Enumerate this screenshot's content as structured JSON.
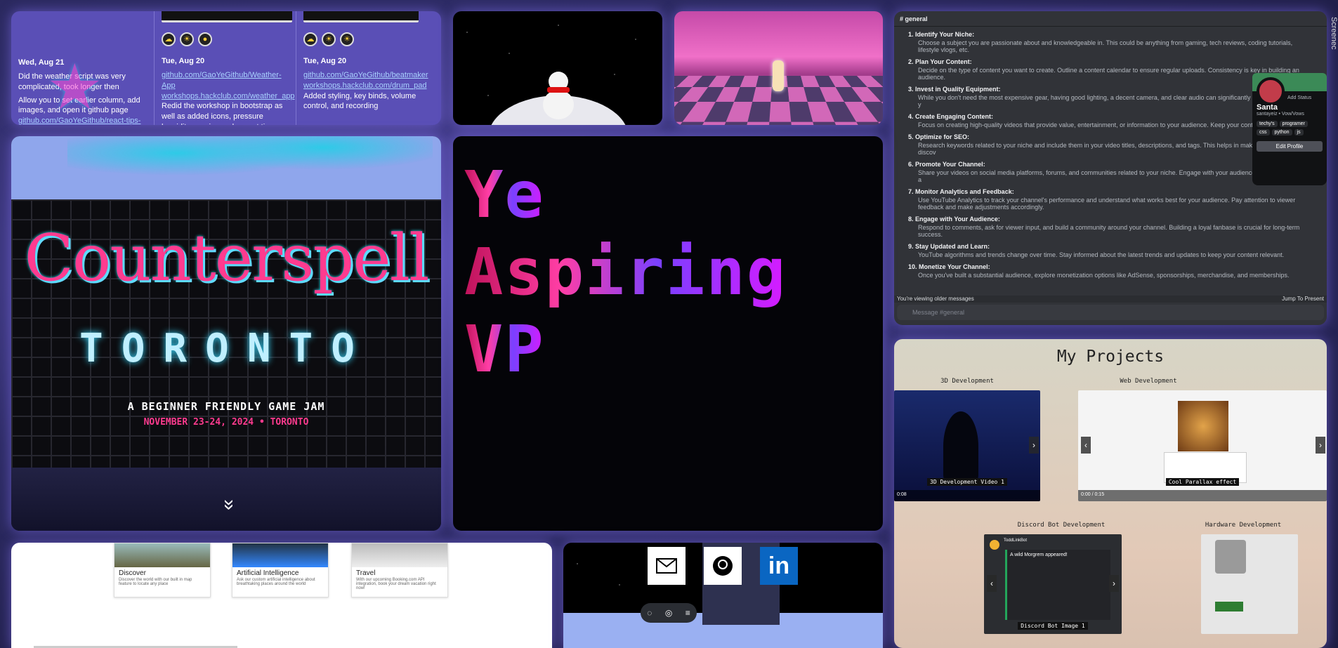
{
  "timeline": {
    "entries": [
      {
        "date": "Wed, Aug 21",
        "text1": "Did the weather script was very complicated, took longer then",
        "text2": "Allow you to set earlier column, add images, and open it github page",
        "link": "github.com/GaoYeGithub/react-tips-list"
      },
      {
        "date": "Tue, Aug 20",
        "link": "github.com/GaoYeGithub/Weather-App",
        "link2": "workshops.hackclub.com/weather_app",
        "text": "Redid the workshop in bootstrap as well as added icons, pressure humidity, sunrise and sunset time, time zone and more"
      },
      {
        "date": "Tue, Aug 20",
        "link": "github.com/GaoYeGithub/beatmaker",
        "link2": "workshops.hackclub.com/drum_pad",
        "text": "Added styling, key binds, volume control, and recording"
      }
    ]
  },
  "discord": {
    "channel": "general",
    "items": [
      {
        "h": "1. Identify Your Niche:",
        "d": "Choose a subject you are passionate about and knowledgeable in. This could be anything from gaming, tech reviews, coding tutorials, lifestyle vlogs, etc."
      },
      {
        "h": "2. Plan Your Content:",
        "d": "Decide on the type of content you want to create. Outline a content calendar to ensure regular uploads. Consistency is key in building an audience."
      },
      {
        "h": "3. Invest in Quality Equipment:",
        "d": "While you don't need the most expensive gear, having good lighting, a decent camera, and clear audio can significantly improve the quality of y"
      },
      {
        "h": "4. Create Engaging Content:",
        "d": "Focus on creating high-quality videos that provide value, entertainment, or information to your audience. Keep your content engaging and rel"
      },
      {
        "h": "5. Optimize for SEO:",
        "d": "Research keywords related to your niche and include them in your video titles, descriptions, and tags. This helps in making your videos discov"
      },
      {
        "h": "6. Promote Your Channel:",
        "d": "Share your videos on social media platforms, forums, and communities related to your niche. Engage with your audience through comments a"
      },
      {
        "h": "7. Monitor Analytics and Feedback:",
        "d": "Use YouTube Analytics to track your channel's performance and understand what works best for your audience. Pay attention to viewer feedback and make adjustments accordingly."
      },
      {
        "h": "8. Engage with Your Audience:",
        "d": "Respond to comments, ask for viewer input, and build a community around your channel. Building a loyal fanbase is crucial for long-term success."
      },
      {
        "h": "9. Stay Updated and Learn:",
        "d": "YouTube algorithms and trends change over time. Stay informed about the latest trends and updates to keep your content relevant."
      },
      {
        "h": "10. Monetize Your Channel:",
        "d": "Once you've built a substantial audience, explore monetization options like AdSense, sponsorships, merchandise, and memberships."
      }
    ],
    "older_text": "You're viewing older messages",
    "jump_text": "Jump To Present",
    "input_placeholder": "Message #general",
    "profile": {
      "name": "Santa",
      "handle": "santayeiz • Vow/Vows",
      "status_btn": "Add Status",
      "tags": [
        "techy's",
        "programer",
        "css",
        "python",
        "js"
      ],
      "edit": "Edit Profile"
    }
  },
  "side_label": "Screenec",
  "counterspell": {
    "title": "Counterspell",
    "city": "TORONTO",
    "subtitle": "A BEGINNER FRIENDLY GAME JAM",
    "date": "NOVEMBER 23-24, 2024 • TORONTO",
    "chevron": "»"
  },
  "hero": {
    "line1": "Ye",
    "line2": "Aspiring",
    "line3": "VP"
  },
  "projects": {
    "title": "My Projects",
    "categories": [
      {
        "name": "3D Development",
        "caption": "3D Development Video 1",
        "time": "0:08"
      },
      {
        "name": "Web Development",
        "caption": "Cool Parallax effect",
        "time": "0:00 / 0:15"
      },
      {
        "name": "Discord Bot Development",
        "caption": "Discord Bot Image 1",
        "embed_title": "A wild Morgrem appeared!",
        "embed_bot": "ToddLinkBot"
      },
      {
        "name": "Hardware Development"
      }
    ]
  },
  "travel": {
    "cards": [
      {
        "title": "Discover",
        "desc": "Discover the world with our built in map feature to locate any place"
      },
      {
        "title": "Artificial Intelligence",
        "desc": "Ask our custom artificial intelligence about breathtaking places around the world"
      },
      {
        "title": "Travel",
        "desc": "With our upcoming Booking.com API integration, book your dream vacation right now!"
      }
    ]
  },
  "contact": {
    "email_icon": "email-icon",
    "github_icon": "github-icon",
    "linkedin_label": "in"
  }
}
